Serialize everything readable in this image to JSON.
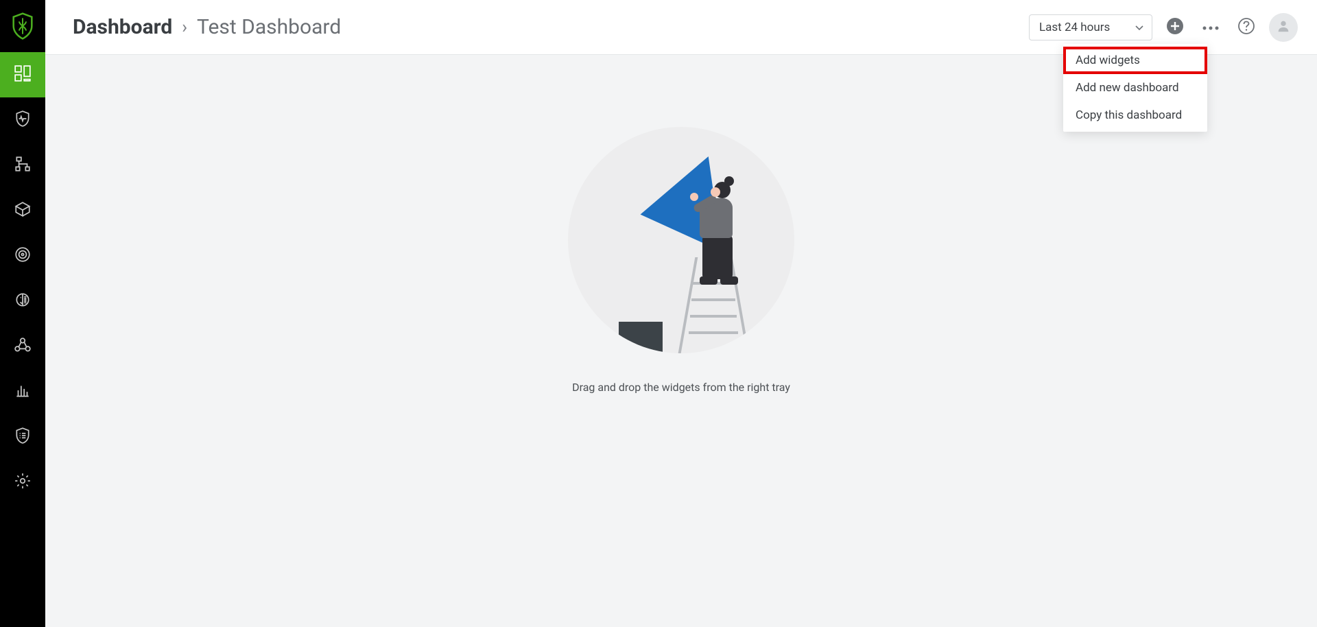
{
  "sidebar": {
    "items": [
      {
        "name": "dashboard",
        "active": true
      },
      {
        "name": "security"
      },
      {
        "name": "topology"
      },
      {
        "name": "packages"
      },
      {
        "name": "radar"
      },
      {
        "name": "identity"
      },
      {
        "name": "integrations"
      },
      {
        "name": "analytics"
      },
      {
        "name": "checklist"
      },
      {
        "name": "settings"
      }
    ]
  },
  "header": {
    "breadcrumb_root": "Dashboard",
    "breadcrumb_sep": "›",
    "breadcrumb_current": "Test Dashboard",
    "time_range": "Last 24 hours"
  },
  "dropdown": {
    "items": [
      {
        "label": "Add widgets",
        "highlight": true
      },
      {
        "label": "Add new dashboard",
        "highlight": false
      },
      {
        "label": "Copy this dashboard",
        "highlight": false
      }
    ]
  },
  "content": {
    "empty_hint": "Drag and drop the widgets from the right tray"
  }
}
